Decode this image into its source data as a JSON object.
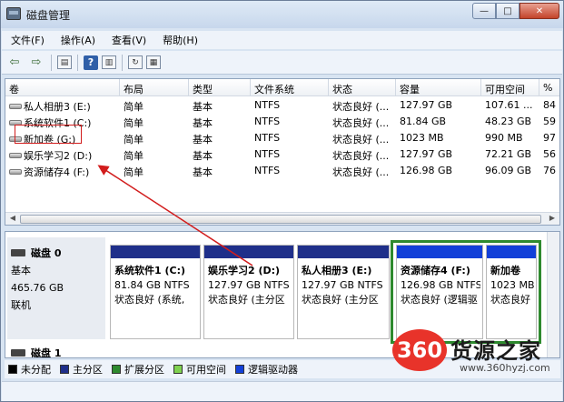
{
  "window": {
    "title": "磁盘管理",
    "minimize": "—",
    "maximize": "□",
    "close": "✕"
  },
  "menu": [
    "文件(F)",
    "操作(A)",
    "查看(V)",
    "帮助(H)"
  ],
  "toolbar": {
    "icons": [
      "back-icon",
      "forward-icon",
      "console-tree-icon",
      "help-icon",
      "properties-icon",
      "refresh-icon",
      "show-hide-icon"
    ],
    "back": "⇦",
    "forward": "⇨",
    "help": "?",
    "refresh": "↻"
  },
  "columns": [
    "卷",
    "布局",
    "类型",
    "文件系统",
    "状态",
    "容量",
    "可用空间",
    "%"
  ],
  "volumes": [
    {
      "name": "私人相册3 (E:)",
      "layout": "简单",
      "type": "基本",
      "fs": "NTFS",
      "status": "状态良好 (...",
      "capacity": "127.97 GB",
      "free": "107.61 ...",
      "pct": "84"
    },
    {
      "name": "系统软件1 (C:)",
      "layout": "简单",
      "type": "基本",
      "fs": "NTFS",
      "status": "状态良好 (...",
      "capacity": "81.84 GB",
      "free": "48.23 GB",
      "pct": "59"
    },
    {
      "name": "新加卷 (G:)",
      "layout": "简单",
      "type": "基本",
      "fs": "NTFS",
      "status": "状态良好 (...",
      "capacity": "1023 MB",
      "free": "990 MB",
      "pct": "97"
    },
    {
      "name": "娱乐学习2 (D:)",
      "layout": "简单",
      "type": "基本",
      "fs": "NTFS",
      "status": "状态良好 (...",
      "capacity": "127.97 GB",
      "free": "72.21 GB",
      "pct": "56"
    },
    {
      "name": "资源储存4 (F:)",
      "layout": "简单",
      "type": "基本",
      "fs": "NTFS",
      "status": "状态良好 (...",
      "capacity": "126.98 GB",
      "free": "96.09 GB",
      "pct": "76"
    }
  ],
  "disk0": {
    "name": "磁盘 0",
    "type": "基本",
    "size": "465.76 GB",
    "state": "联机"
  },
  "partitions": [
    {
      "name": "系统软件1 (C:)",
      "info": "81.84 GB NTFS",
      "status": "状态良好 (系统,",
      "bar": "#1f2f8a"
    },
    {
      "name": "娱乐学习2 (D:)",
      "info": "127.97 GB NTFS",
      "status": "状态良好 (主分区",
      "bar": "#1f2f8a"
    },
    {
      "name": "私人相册3 (E:)",
      "info": "127.97 GB NTFS",
      "status": "状态良好 (主分区",
      "bar": "#1f2f8a"
    },
    {
      "name": "资源储存4 (F:)",
      "info": "126.98 GB NTFS",
      "status": "状态良好 (逻辑驱",
      "bar": "#1240d8"
    },
    {
      "name": "新加卷",
      "info": "1023 MB",
      "status": "状态良好",
      "bar": "#1240d8"
    }
  ],
  "disk1": {
    "name": "磁盘 1"
  },
  "legend": [
    {
      "label": "未分配",
      "color": "#000000"
    },
    {
      "label": "主分区",
      "color": "#1f2f8a"
    },
    {
      "label": "扩展分区",
      "color": "#2e8a2e"
    },
    {
      "label": "可用空间",
      "color": "#7fd14f"
    },
    {
      "label": "逻辑驱动器",
      "color": "#1240d8"
    }
  ],
  "watermark": {
    "logo": "360",
    "text": "货源之家",
    "url": "www.360hyzj.com"
  }
}
